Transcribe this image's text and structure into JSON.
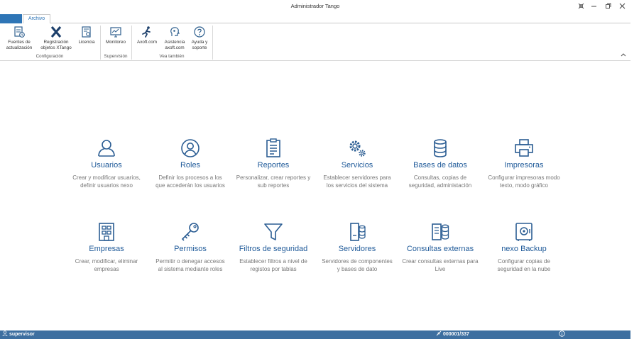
{
  "window": {
    "title": "Administrador Tango"
  },
  "tabs": {
    "archivo": "Archivo"
  },
  "ribbon": {
    "groups": [
      {
        "label": "Configuración"
      },
      {
        "label": "Supervisión"
      },
      {
        "label": "Vea también"
      }
    ],
    "buttons": {
      "fuentes": [
        "Fuentes de",
        "actualización"
      ],
      "registracion": [
        "Registración",
        "objetos XTango"
      ],
      "licencia": [
        "Licencia"
      ],
      "monitoreo": [
        "Monitoreo"
      ],
      "axoft": [
        "Axoft.com"
      ],
      "asistencia": [
        "Asistencia",
        "axoft.com"
      ],
      "ayuda": [
        "Ayuda y",
        "soporte"
      ]
    }
  },
  "tiles": [
    {
      "title": "Usuarios",
      "desc": [
        "Crear y modificar usuarios,",
        "definir usuarios nexo"
      ],
      "icon": "user-icon"
    },
    {
      "title": "Roles",
      "desc": [
        "Definir los procesos a los",
        "que accederán los usuarios"
      ],
      "icon": "roles-icon"
    },
    {
      "title": "Reportes",
      "desc": [
        "Personalizar, crear reportes y",
        "sub reportes"
      ],
      "icon": "report-icon"
    },
    {
      "title": "Servicios",
      "desc": [
        "Establecer servidores para",
        "los servicios del sistema"
      ],
      "icon": "gears-icon"
    },
    {
      "title": "Bases de datos",
      "desc": [
        "Consultas, copias de",
        "seguridad, administación"
      ],
      "icon": "database-icon"
    },
    {
      "title": "Impresoras",
      "desc": [
        "Configurar impresoras modo",
        "texto, modo gráfico"
      ],
      "icon": "printer-icon"
    },
    {
      "title": "Empresas",
      "desc": [
        "Crear, modificar, eliminar",
        "empresas"
      ],
      "icon": "building-icon"
    },
    {
      "title": "Permisos",
      "desc": [
        "Permitir o denegar accesos",
        "al sistema mediante roles"
      ],
      "icon": "key-icon"
    },
    {
      "title": "Filtros de seguridad",
      "desc": [
        "Establecer filtros a nivel de",
        "registos por tablas"
      ],
      "icon": "filter-icon"
    },
    {
      "title": "Servidores",
      "desc": [
        "Servidores de componentes",
        "y bases de dato"
      ],
      "icon": "server-icon"
    },
    {
      "title": "Consultas externas",
      "desc": [
        "Crear consultas externas para",
        "Live"
      ],
      "icon": "external-query-icon"
    },
    {
      "title": "nexo Backup",
      "desc": [
        "Configurar copias de",
        "seguridad en la nube"
      ],
      "icon": "safe-icon"
    }
  ],
  "status": {
    "user": "supervisor",
    "code": "000001/337"
  },
  "colors": {
    "accent": "#2e75b6",
    "tile_title": "#1f5a99",
    "status_bar": "#3d6fa0"
  }
}
